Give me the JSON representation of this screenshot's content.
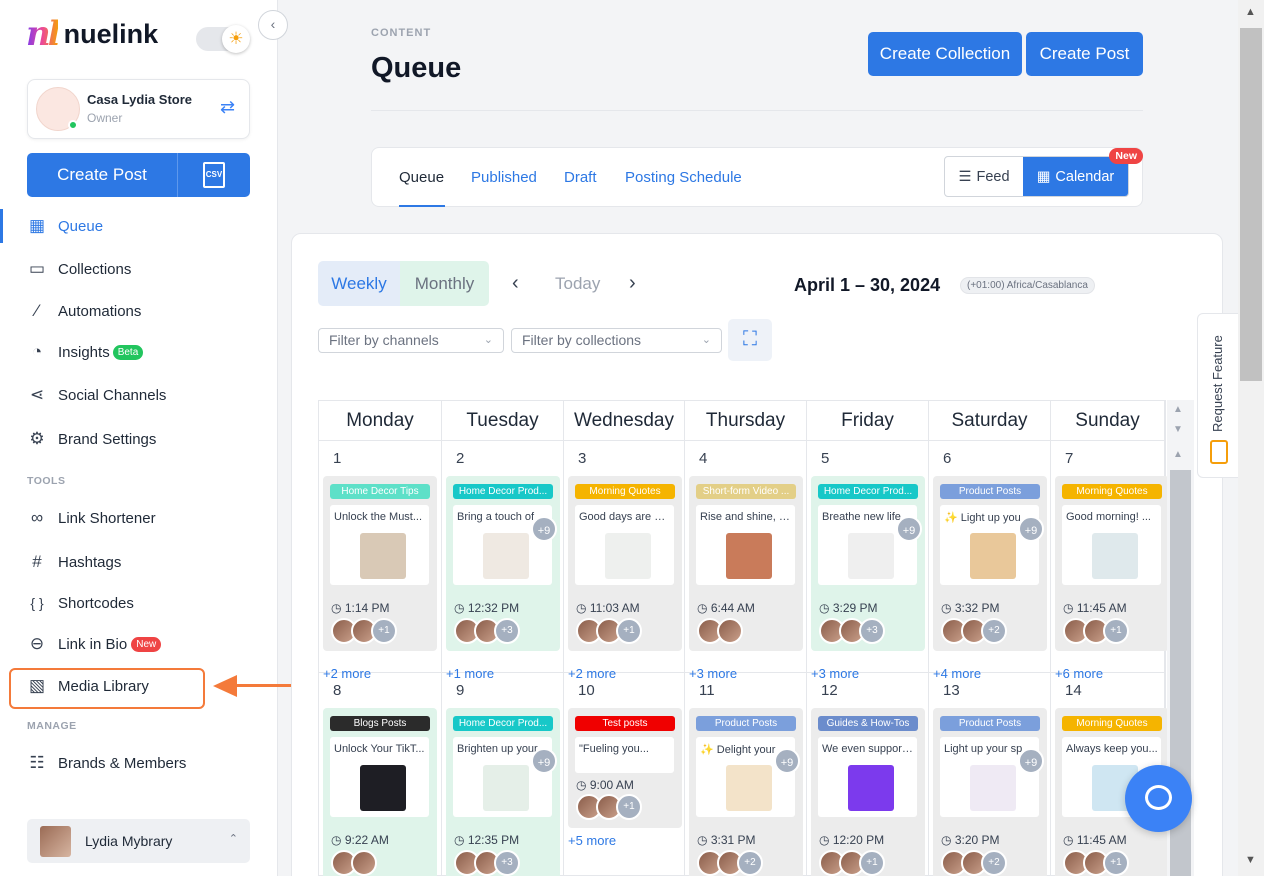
{
  "brand": {
    "logo_mark": "nl",
    "name": "nuelink"
  },
  "account": {
    "name": "Casa Lydia Store",
    "role": "Owner"
  },
  "sidebar": {
    "create_post": "Create Post",
    "csv_label": "CSV",
    "nav": [
      {
        "label": "Queue",
        "icon": "calendar-icon"
      },
      {
        "label": "Collections",
        "icon": "folder-icon"
      },
      {
        "label": "Automations",
        "icon": "magic-wand-icon"
      },
      {
        "label": "Insights",
        "icon": "pie-chart-icon",
        "badge": "Beta"
      },
      {
        "label": "Social Channels",
        "icon": "share-icon"
      },
      {
        "label": "Brand Settings",
        "icon": "gear-icon"
      }
    ],
    "tools_label": "TOOLS",
    "tools": [
      {
        "label": "Link Shortener",
        "icon": "link-icon"
      },
      {
        "label": "Hashtags",
        "icon": "hashtag-icon"
      },
      {
        "label": "Shortcodes",
        "icon": "braces-icon"
      },
      {
        "label": "Link in Bio",
        "icon": "chain-link-icon",
        "badge": "New"
      },
      {
        "label": "Media Library",
        "icon": "image-stack-icon"
      }
    ],
    "manage_label": "MANAGE",
    "manage": [
      {
        "label": "Brands & Members",
        "icon": "sliders-icon"
      }
    ],
    "user": "Lydia Mybrary"
  },
  "header": {
    "eyebrow": "CONTENT",
    "title": "Queue",
    "create_collection": "Create Collection",
    "create_post": "Create Post"
  },
  "tabs": {
    "items": [
      "Queue",
      "Published",
      "Draft",
      "Posting Schedule"
    ],
    "feed": "Feed",
    "calendar": "Calendar",
    "new_badge": "New"
  },
  "calendar": {
    "weekly": "Weekly",
    "monthly": "Monthly",
    "today": "Today",
    "range": "April 1 – 30, 2024",
    "timezone": "(+01:00) Africa/Casablanca",
    "filter_channels": "Filter by channels",
    "filter_collections": "Filter by collections",
    "days": [
      "Monday",
      "Tuesday",
      "Wednesday",
      "Thursday",
      "Friday",
      "Saturday",
      "Sunday"
    ],
    "week1": [
      {
        "date": "1",
        "tag": "Home Decor Tips",
        "tag_color": "#5ee0c8",
        "text": "Unlock the Must...",
        "time": "1:14 PM",
        "plus": "",
        "more_avatar": "+1",
        "more": "+2 more",
        "thumb_color": "#d9c9b6",
        "green": false
      },
      {
        "date": "2",
        "tag": "Home Decor Prod...",
        "tag_color": "#17c8c8",
        "text": "Bring a touch of",
        "time": "12:32 PM",
        "plus": "+9",
        "more_avatar": "+3",
        "more": "+1 more",
        "thumb_color": "#efe9e2",
        "green": true
      },
      {
        "date": "3",
        "tag": "Morning Quotes",
        "tag_color": "#f5b400",
        "text": "Good days are al...",
        "time": "11:03 AM",
        "plus": "",
        "more_avatar": "+1",
        "more": "+2 more",
        "thumb_color": "#eef0ee",
        "green": false
      },
      {
        "date": "4",
        "tag": "Short-form Video ...",
        "tag_color": "#e3cf87",
        "text": "Rise and shine, b...",
        "time": "6:44 AM",
        "plus": "",
        "more_avatar": "",
        "more": "+3 more",
        "thumb_color": "#c97b5a",
        "green": false
      },
      {
        "date": "5",
        "tag": "Home Decor Prod...",
        "tag_color": "#17c8c8",
        "text": "Breathe new life",
        "time": "3:29 PM",
        "plus": "+9",
        "more_avatar": "+3",
        "more": "+3 more",
        "thumb_color": "#efefef",
        "green": true
      },
      {
        "date": "6",
        "tag": "Product Posts",
        "tag_color": "#7b9fdc",
        "text": "✨ Light up you",
        "time": "3:32 PM",
        "plus": "+9",
        "more_avatar": "+2",
        "more": "+4 more",
        "thumb_color": "#e9c89a",
        "green": false
      },
      {
        "date": "7",
        "tag": "Morning Quotes",
        "tag_color": "#f5b400",
        "text": "Good morning! ...",
        "time": "11:45 AM",
        "plus": "",
        "more_avatar": "+1",
        "more": "+6 more",
        "thumb_color": "#dfe9ec",
        "green": false
      }
    ],
    "week2": [
      {
        "date": "8",
        "tag": "Blogs Posts",
        "tag_color": "#2b2b2b",
        "text": "Unlock Your TikT...",
        "time": "9:22 AM",
        "plus": "",
        "more_avatar": "",
        "more": "",
        "thumb_color": "#1e1e24",
        "green": true
      },
      {
        "date": "9",
        "tag": "Home Decor Prod...",
        "tag_color": "#17c8c8",
        "text": "Brighten up your",
        "time": "12:35 PM",
        "plus": "+9",
        "more_avatar": "+3",
        "more": "",
        "thumb_color": "#e5efe8",
        "green": true
      },
      {
        "date": "10",
        "tag": "Test posts",
        "tag_color": "#f00000",
        "text": "\"Fueling you...",
        "time": "9:00 AM",
        "plus": "",
        "more_avatar": "+1",
        "more": "+5 more",
        "thumb_color": "",
        "green": false
      },
      {
        "date": "11",
        "tag": "Product Posts",
        "tag_color": "#7b9fdc",
        "text": "✨ Delight your",
        "time": "3:31 PM",
        "plus": "+9",
        "more_avatar": "+2",
        "more": "",
        "thumb_color": "#f3e3c9",
        "green": false
      },
      {
        "date": "12",
        "tag": "Guides & How-Tos",
        "tag_color": "#6b8ccc",
        "text": "We even support...",
        "time": "12:20 PM",
        "plus": "",
        "more_avatar": "+1",
        "more": "",
        "thumb_color": "#7c3aed",
        "green": false
      },
      {
        "date": "13",
        "tag": "Product Posts",
        "tag_color": "#7b9fdc",
        "text": "Light up your sp",
        "time": "3:20 PM",
        "plus": "+9",
        "more_avatar": "+2",
        "more": "",
        "thumb_color": "#efeaf4",
        "green": false
      },
      {
        "date": "14",
        "tag": "Morning Quotes",
        "tag_color": "#f5b400",
        "text": "Always keep you...",
        "time": "11:45 AM",
        "plus": "",
        "more_avatar": "+1",
        "more": "",
        "thumb_color": "#cfe6f2",
        "green": false
      }
    ]
  },
  "request_feature": "Request Feature"
}
